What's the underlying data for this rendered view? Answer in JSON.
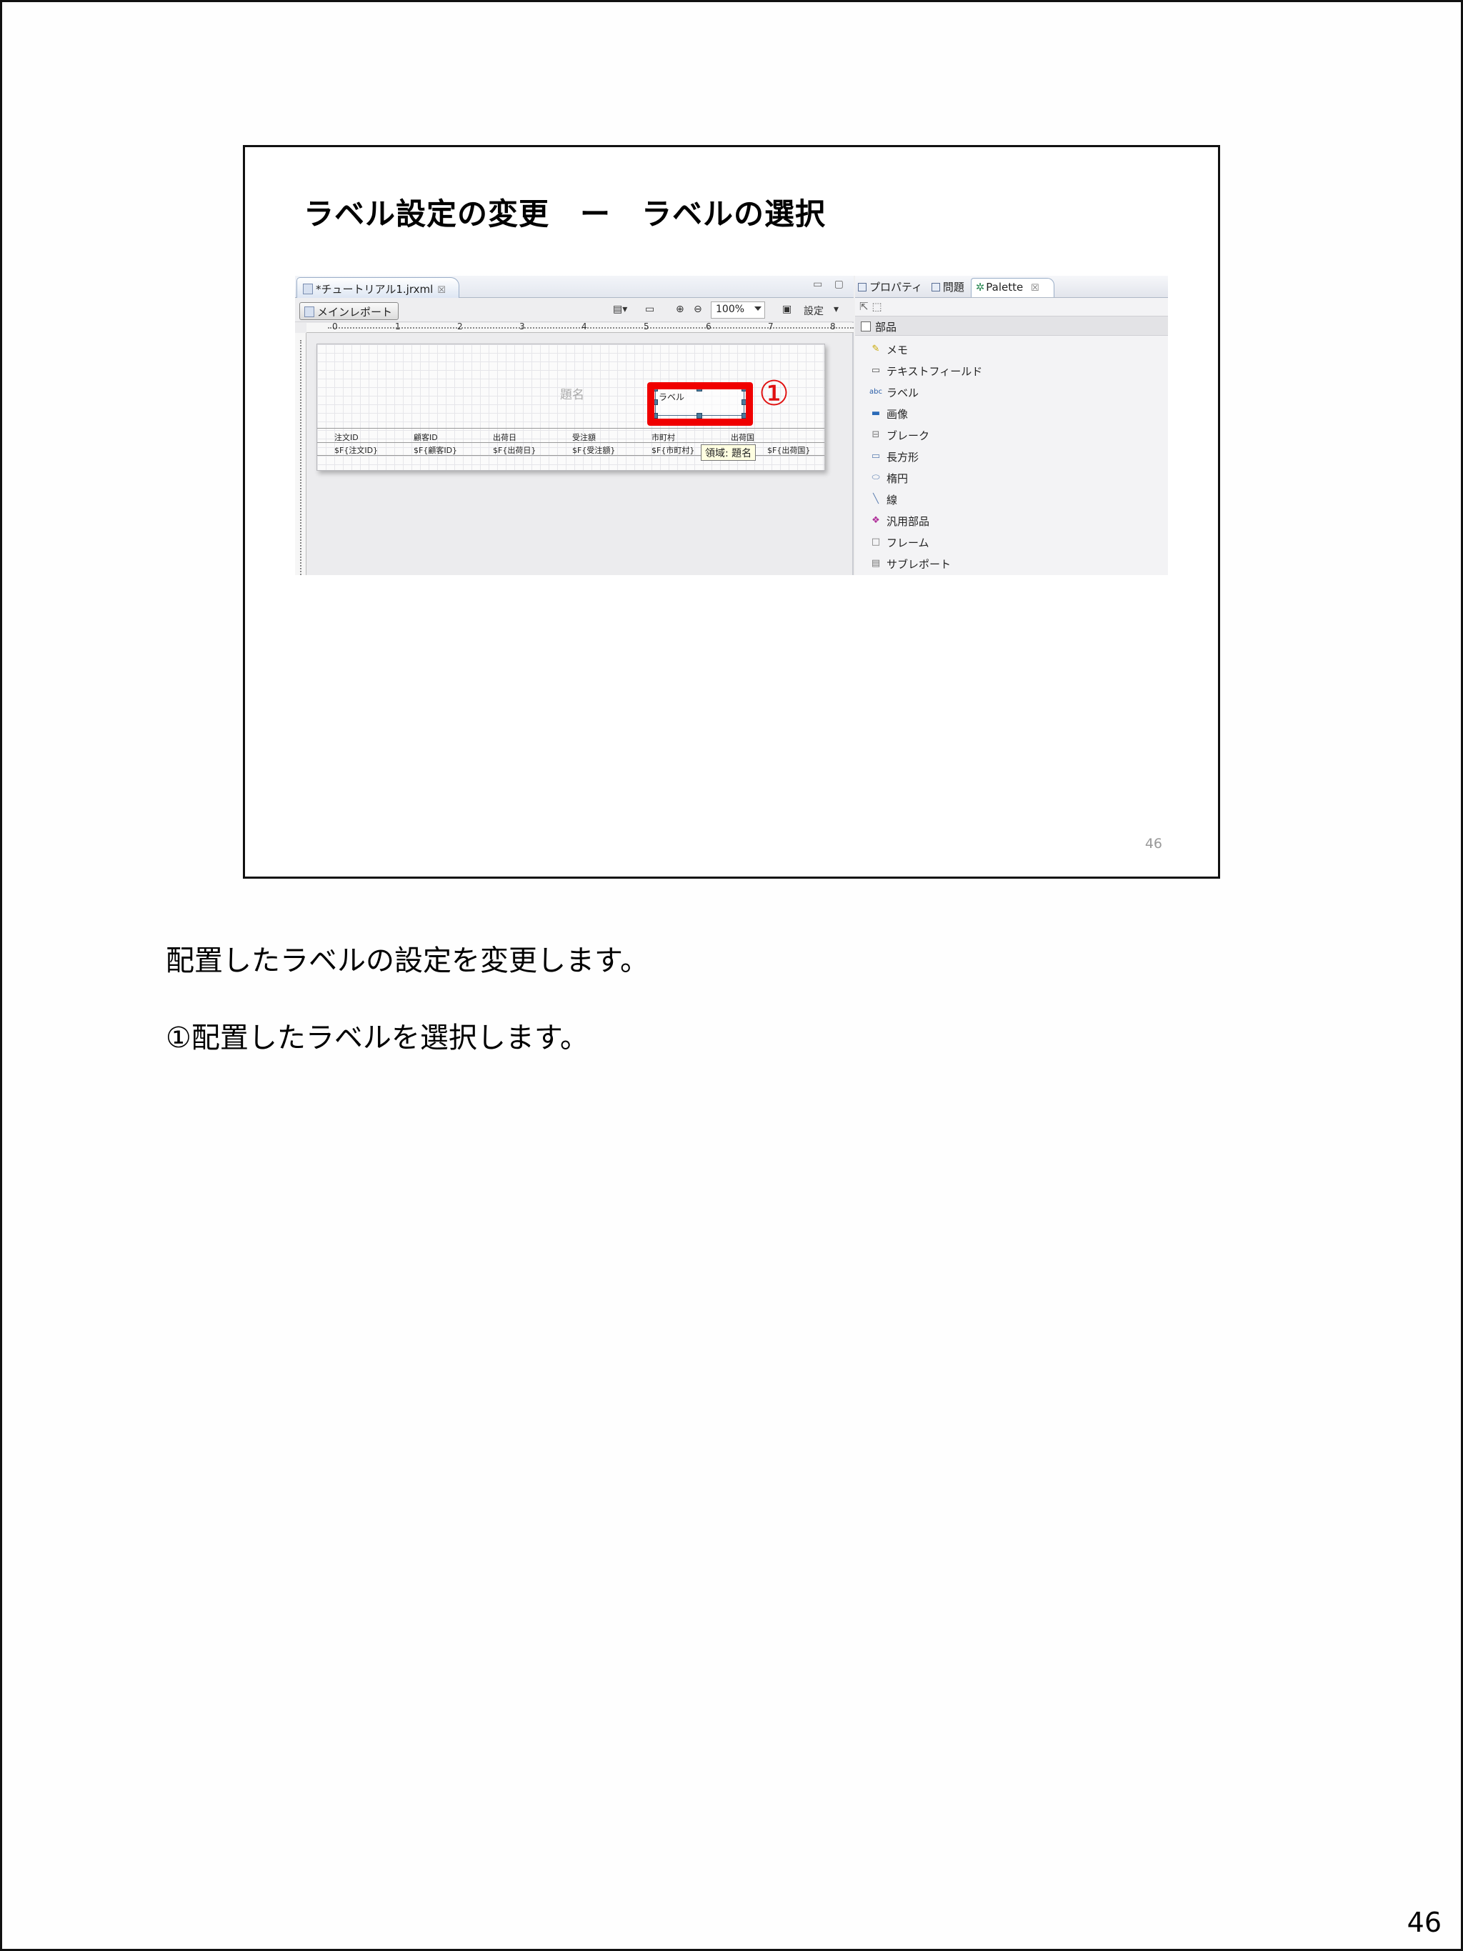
{
  "slide": {
    "title": "ラベル設定の変更　ー　ラベルの選択",
    "slide_number": "46"
  },
  "screenshot": {
    "editor_tab": "*チュートリアル1.jrxml",
    "editor_tab_close": "☒",
    "window_controls": "▭ ▢",
    "toolbar": {
      "main_report": "メインレポート",
      "zoom": "100%",
      "settings": "設定"
    },
    "ruler_marks": [
      "0",
      "1",
      "2",
      "3",
      "4",
      "5",
      "6",
      "7",
      "8"
    ],
    "report": {
      "title_placeholder": "題名",
      "label_text": "ラベル",
      "circle_number": "①",
      "headers": [
        "注文ID",
        "顧客ID",
        "出荷日",
        "受注額",
        "市町村",
        "出荷国"
      ],
      "details": [
        "$F{注文ID}",
        "$F{顧客ID}",
        "$F{出荷日}",
        "$F{受注額}",
        "$F{市町村}",
        "$F{出荷国}"
      ],
      "tooltip": "領域: 題名"
    },
    "panel": {
      "tabs": [
        "プロパティ",
        "問題",
        "Palette"
      ],
      "section": "部品",
      "items": [
        {
          "label": "メモ",
          "icon": "memo-icon"
        },
        {
          "label": "テキストフィールド",
          "icon": "textfield-icon"
        },
        {
          "label": "ラベル",
          "icon": "label-icon"
        },
        {
          "label": "画像",
          "icon": "image-icon"
        },
        {
          "label": "ブレーク",
          "icon": "break-icon"
        },
        {
          "label": "長方形",
          "icon": "rectangle-icon"
        },
        {
          "label": "楕円",
          "icon": "ellipse-icon"
        },
        {
          "label": "線",
          "icon": "line-icon"
        },
        {
          "label": "汎用部品",
          "icon": "generic-icon"
        },
        {
          "label": "フレーム",
          "icon": "frame-icon"
        },
        {
          "label": "サブレポート",
          "icon": "subreport-icon"
        }
      ]
    }
  },
  "notes": {
    "line1": "配置したラベルの設定を変更します。",
    "line2": "①配置したラベルを選択します。"
  },
  "page_number": "46",
  "colors": {
    "highlight": "#f00000",
    "frame": "#111111"
  }
}
